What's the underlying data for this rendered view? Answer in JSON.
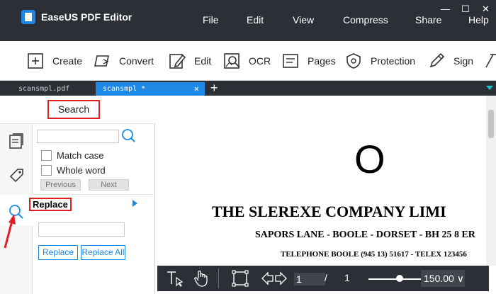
{
  "app": {
    "title": "EaseUS PDF Editor",
    "icon": "easeus-pdf-logo-icon"
  },
  "menu": [
    "File",
    "Edit",
    "View",
    "Compress",
    "Share",
    "Help"
  ],
  "window_controls": {
    "minimize": "—",
    "maximize": "☐",
    "close": "✕"
  },
  "toolbar": {
    "items": [
      {
        "label": "Create",
        "icon": "plus-square-icon"
      },
      {
        "label": "Convert",
        "icon": "convert-icon"
      },
      {
        "label": "Edit",
        "icon": "edit-pencil-icon"
      },
      {
        "label": "OCR",
        "icon": "ocr-scan-icon"
      },
      {
        "label": "Pages",
        "icon": "pages-icon"
      },
      {
        "label": "Protection",
        "icon": "shield-icon"
      },
      {
        "label": "Sign",
        "icon": "sign-pen-icon"
      }
    ]
  },
  "tabs": [
    {
      "label": "scansmpl.pdf",
      "active": false
    },
    {
      "label": "scansmpl *",
      "active": true,
      "close": "✕"
    }
  ],
  "tab_add": "+",
  "rail": {
    "items": [
      {
        "icon": "thumbnails-icon"
      },
      {
        "icon": "tag-icon"
      },
      {
        "icon": "search-icon",
        "active": true
      }
    ]
  },
  "search_panel": {
    "title": "Search",
    "search_value": "",
    "match_case": "Match case",
    "whole_word": "Whole word",
    "previous": "Previous",
    "next": "Next",
    "replace_title": "Replace",
    "replace_value": "",
    "replace_button": "Replace",
    "replace_all_button": "Replace All"
  },
  "document": {
    "letter": "O",
    "heading": "THE SLEREXE COMPANY LIMI",
    "line2": "SAPORS LANE - BOOLE - DORSET - BH 25 8 ER",
    "line3": "TELEPHONE BOOLE (945 13) 51617 - TELEX 123456"
  },
  "doc_toolbar": {
    "current_page": "1",
    "page_separator": "/",
    "total_pages": "1",
    "zoom": "150.00 ∨",
    "zoom_slider_fraction": 0.6
  },
  "colors": {
    "titlebar": "#2c2f36",
    "accent": "#1e88e5",
    "annotation_red": "#e02020"
  }
}
